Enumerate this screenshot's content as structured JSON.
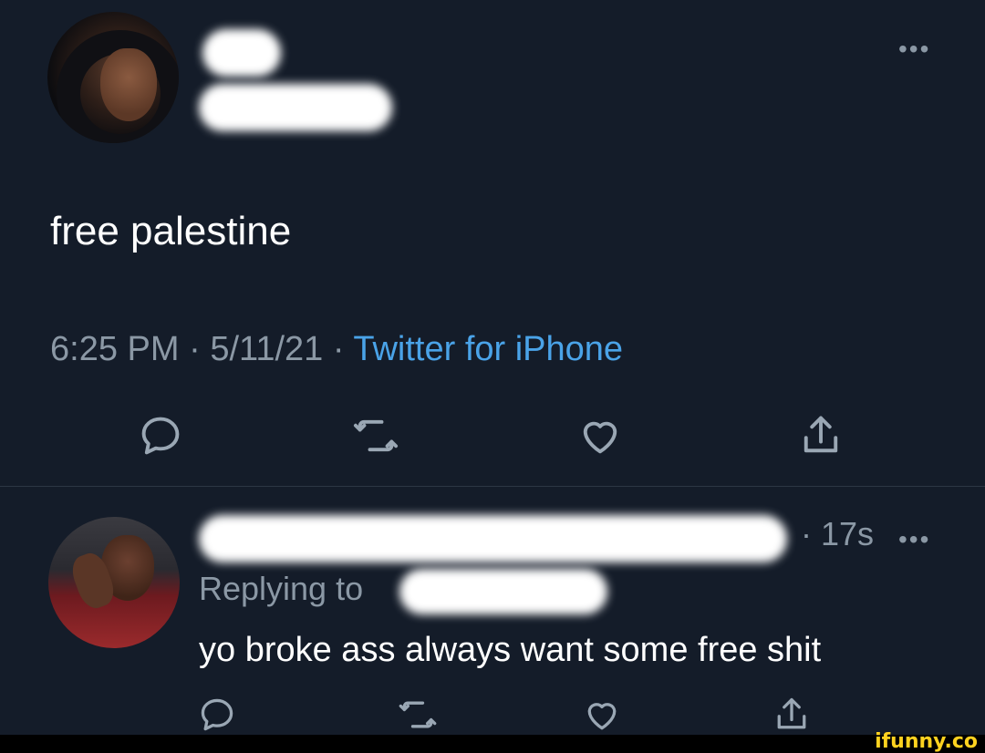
{
  "tweet": {
    "text": "free palestine",
    "time": "6:25 PM",
    "date": "5/11/21",
    "source": "Twitter for iPhone",
    "separator": "·",
    "more_icon": "more-dots-icon"
  },
  "reply": {
    "time_ago": "· 17s",
    "replying_prefix": "Replying to",
    "text": "yo broke ass always want some free shit",
    "more_icon": "more-dots-icon"
  },
  "actions": {
    "reply_icon": "speech-bubble-icon",
    "retweet_icon": "retweet-icon",
    "like_icon": "heart-icon",
    "share_icon": "share-icon"
  },
  "watermark": "ifunny.co",
  "colors": {
    "background": "#141c29",
    "text": "#ffffff",
    "muted": "#8b98a5",
    "link": "#4aa3e8",
    "watermark": "#ffd21f"
  }
}
